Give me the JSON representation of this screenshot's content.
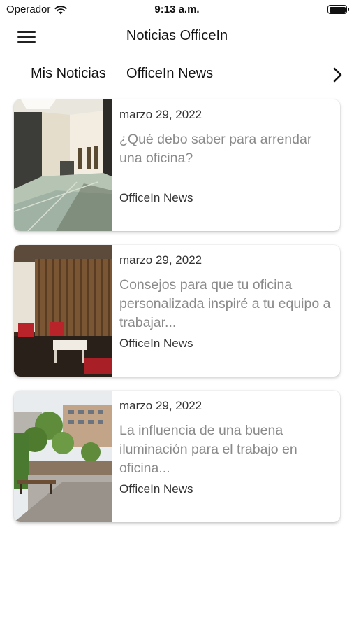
{
  "status_bar": {
    "carrier": "Operador",
    "time": "9:13 a.m."
  },
  "nav": {
    "title": "Noticias OfficeIn",
    "menu_icon": "hamburger-menu-icon"
  },
  "tabs": [
    {
      "label": "Mis Noticias"
    },
    {
      "label": "OfficeIn News"
    }
  ],
  "tabs_next_icon": "chevron-right-icon",
  "news": [
    {
      "date": "marzo 29, 2022",
      "title": "¿Qué debo saber para arrendar una oficina?",
      "source": "OfficeIn News",
      "image": "office-lobby-photo"
    },
    {
      "date": "marzo 29, 2022",
      "title": "Consejos para que tu oficina personalizada inspiré a tu equipo a trabajar...",
      "source": "OfficeIn News",
      "image": "office-lounge-photo"
    },
    {
      "date": "marzo 29, 2022",
      "title": "La influencia de una buena iluminación para el trabajo en oficina...",
      "source": "OfficeIn News",
      "image": "rooftop-terrace-photo"
    }
  ]
}
